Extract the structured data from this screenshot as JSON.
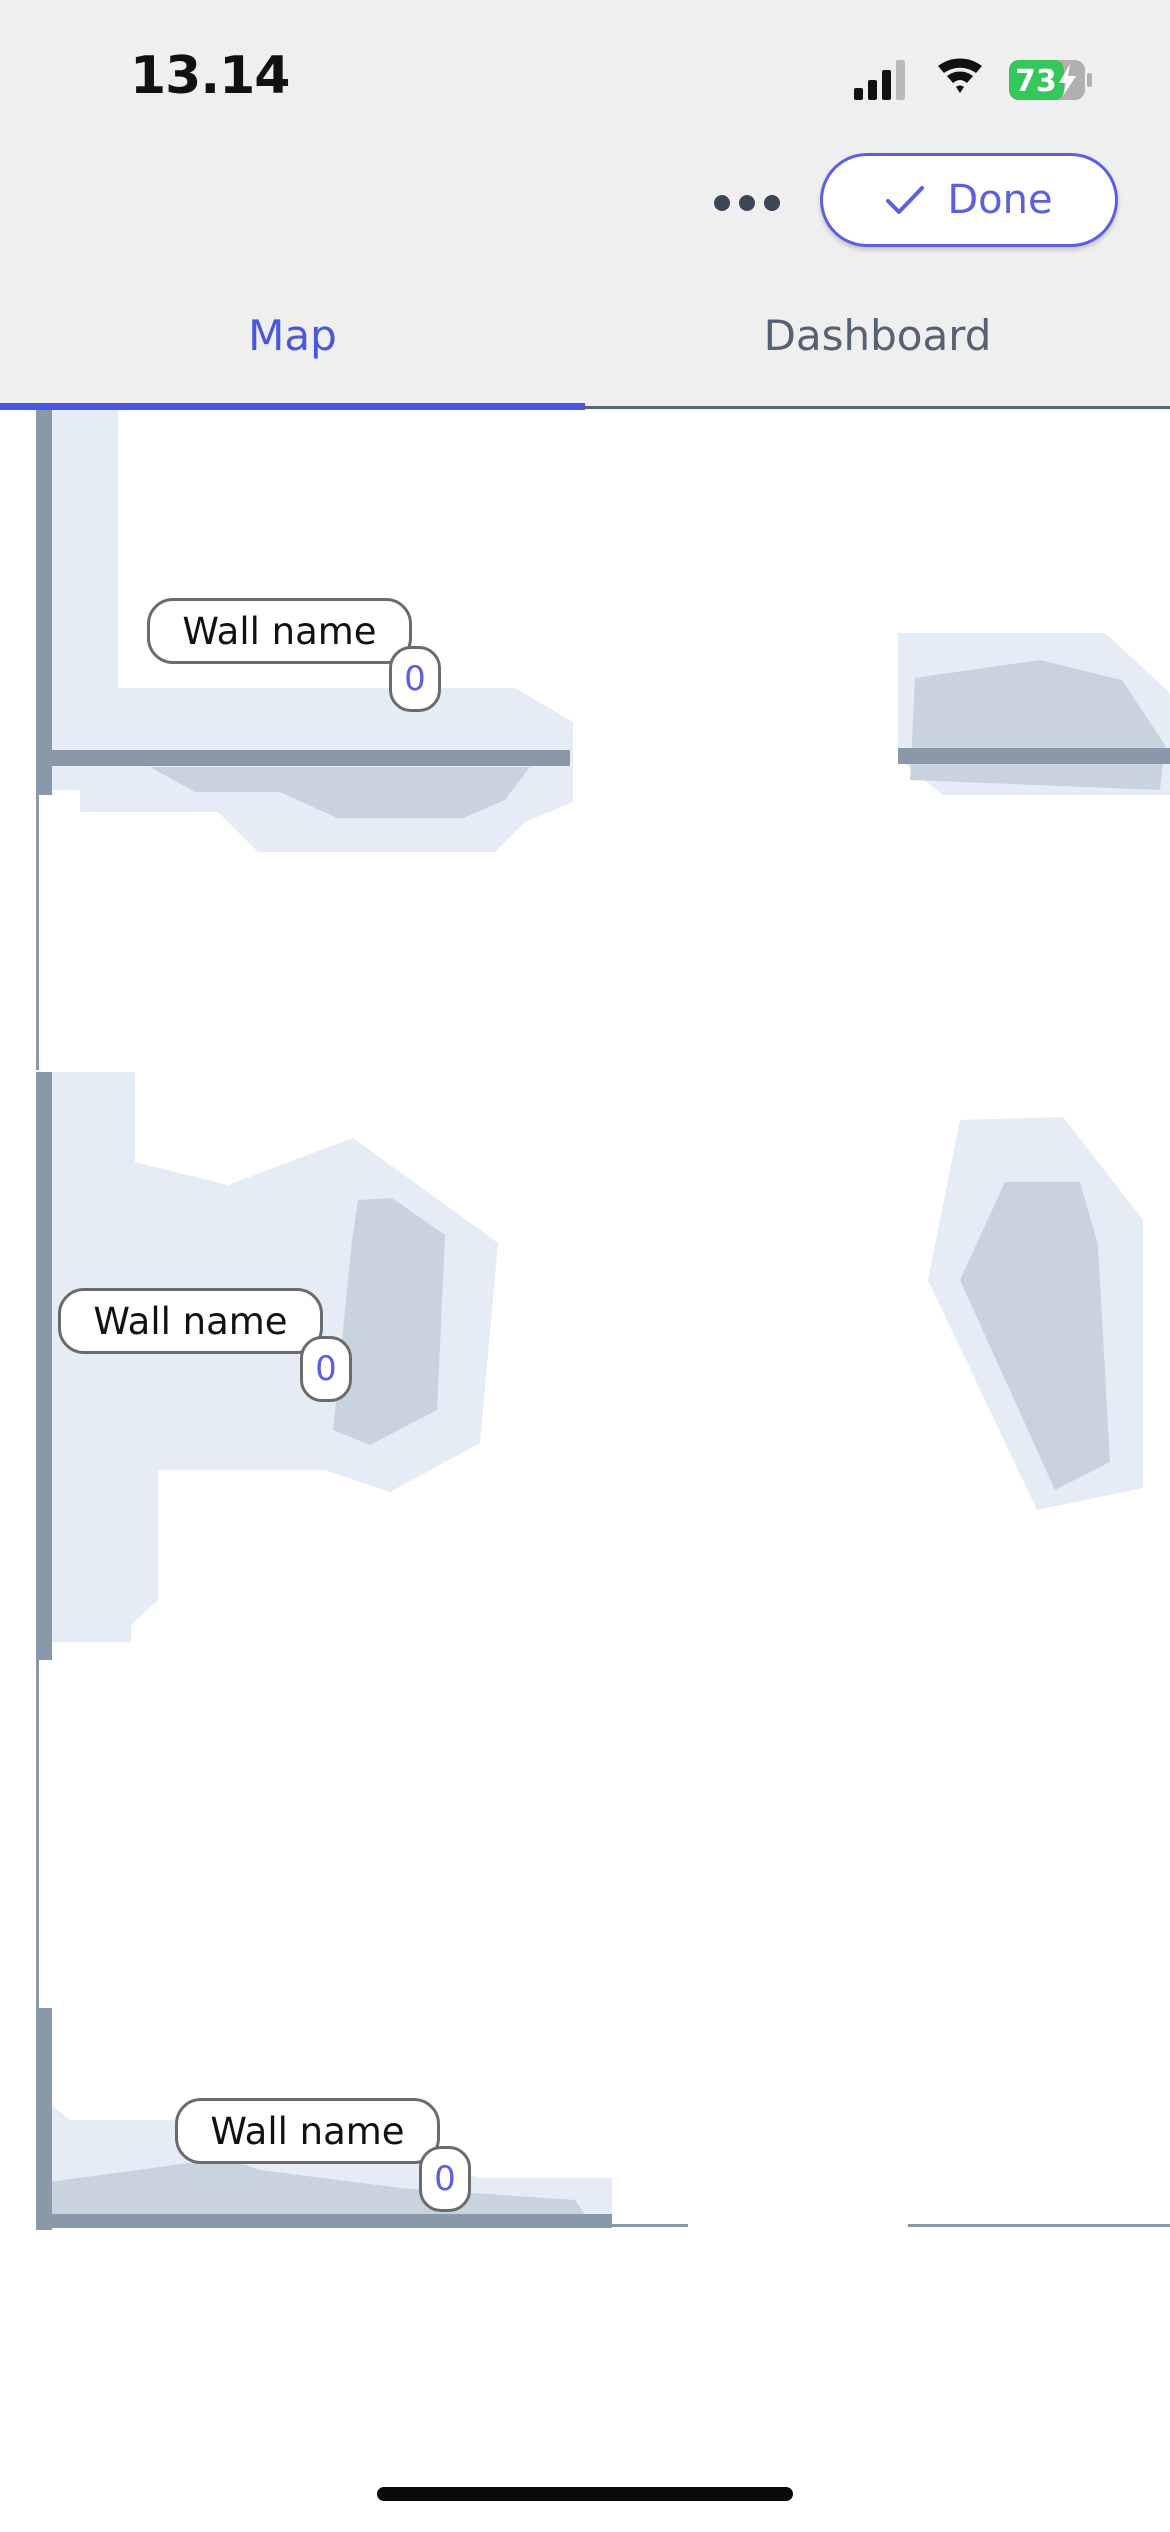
{
  "status_bar": {
    "time": "13.14",
    "battery_level": "73",
    "battery_charging": true,
    "icons": [
      "cellular-signal-icon",
      "wifi-icon",
      "battery-icon",
      "charging-bolt-icon"
    ]
  },
  "toolbar": {
    "more_icon": "ellipsis-icon",
    "done_label": "Done",
    "done_icon": "checkmark-icon"
  },
  "tabs": [
    {
      "label": "Map",
      "active": true
    },
    {
      "label": "Dashboard",
      "active": false
    }
  ],
  "walls": [
    {
      "name": "Wall name",
      "count": "0"
    },
    {
      "name": "Wall name",
      "count": "0"
    },
    {
      "name": "Wall name",
      "count": "0"
    }
  ],
  "colors": {
    "accent": "#4a55e0",
    "wall": "#8a99aa",
    "coverage_light": "#e5ecf5",
    "coverage_dark": "#c9d3de",
    "battery_green": "#34c759"
  }
}
